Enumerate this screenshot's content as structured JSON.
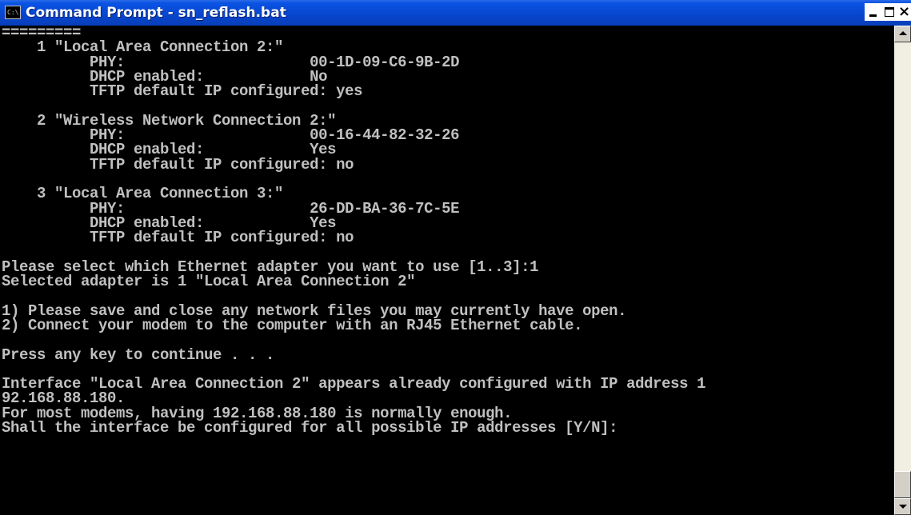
{
  "window": {
    "title": "Command Prompt - sn_reflash.bat",
    "icon": "cmd-icon",
    "icon_text": "C:\\",
    "controls": {
      "minimize_icon": "minimize-icon",
      "maximize_icon": "maximize-icon",
      "close_icon": "close-icon",
      "close_glyph": "×"
    }
  },
  "colors": {
    "titlebar": "#0846cf",
    "console_bg": "#000000",
    "console_fg": "#c0c0c0"
  },
  "console": {
    "lines": [
      "=========",
      "    1 \"Local Area Connection 2:\"",
      "          PHY:                     00-1D-09-C6-9B-2D",
      "          DHCP enabled:            No",
      "          TFTP default IP configured: yes",
      "",
      "    2 \"Wireless Network Connection 2:\"",
      "          PHY:                     00-16-44-82-32-26",
      "          DHCP enabled:            Yes",
      "          TFTP default IP configured: no",
      "",
      "    3 \"Local Area Connection 3:\"",
      "          PHY:                     26-DD-BA-36-7C-5E",
      "          DHCP enabled:            Yes",
      "          TFTP default IP configured: no",
      "",
      "Please select which Ethernet adapter you want to use [1..3]:1",
      "Selected adapter is 1 \"Local Area Connection 2\"",
      "",
      "1) Please save and close any network files you may currently have open.",
      "2) Connect your modem to the computer with an RJ45 Ethernet cable.",
      "",
      "Press any key to continue . . .",
      "",
      "Interface \"Local Area Connection 2\" appears already configured with IP address 1",
      "92.168.88.180.",
      "For most modems, having 192.168.88.180 is normally enough.",
      "Shall the interface be configured for all possible IP addresses [Y/N]:"
    ]
  },
  "scrollbar": {
    "up_icon": "scroll-up-arrow-icon",
    "down_icon": "scroll-down-arrow-icon",
    "position_fraction": 1.0
  }
}
